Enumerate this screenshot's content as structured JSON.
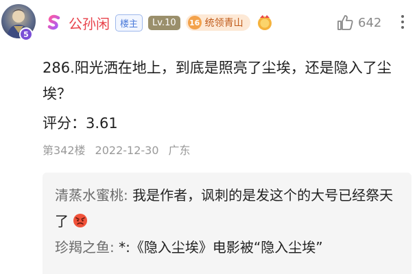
{
  "user": {
    "avatar_icon": "avatar-icon",
    "avatar_badge": "5",
    "brand_icon": "brand-s-icon",
    "name": "公孙闲",
    "host_tag": "楼主",
    "level": "Lv.10",
    "group_level": "16",
    "group_name": "统领青山",
    "medal_icon": "medal-icon"
  },
  "like": {
    "icon": "thumbs-up-icon",
    "count": "642"
  },
  "post": {
    "text": "286.阳光洒在地上，到底是照亮了尘埃，还是隐入了尘埃？",
    "score_label": "评分：",
    "score_value": "3.61",
    "floor": "第342楼",
    "date": "2022-12-30",
    "location": "广东"
  },
  "replies": [
    {
      "name": "清蒸水蜜桃",
      "sep": ":",
      "text": "我是作者，讽刺的是发这个的大号已经祭天了",
      "emoji": "angry-emoji-icon"
    },
    {
      "name": "珍羯之鱼",
      "sep": ":",
      "text": "*:《隐入尘埃》电影被“隐入尘埃”"
    }
  ],
  "colors": {
    "username": "#e8424b",
    "host_tag": "#4a7ad9",
    "level_tag_bg": "#9a8f6b",
    "group_tag_bg": "#fde9d6",
    "reply_bg": "#f5f5f5"
  }
}
